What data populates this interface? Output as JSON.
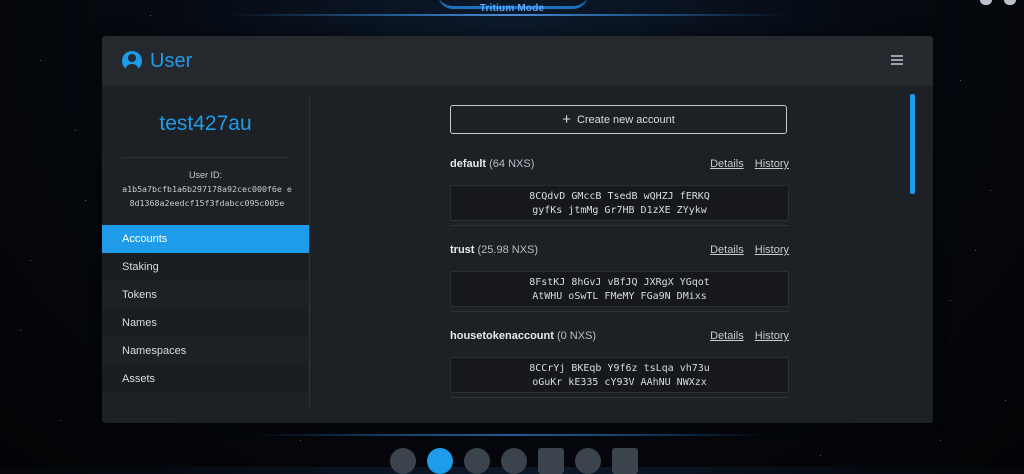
{
  "app": {
    "mode_label": "Tritium Mode"
  },
  "header": {
    "title": "User"
  },
  "sidebar": {
    "username": "test427au",
    "user_id_label": "User ID:",
    "user_id": "a1b5a7bcfb1a6b297178a92cec000f6e e8d1368a2eedcf15f3fdabcc095c005e",
    "items": [
      {
        "label": "Accounts",
        "active": true
      },
      {
        "label": "Staking",
        "active": false
      },
      {
        "label": "Tokens",
        "active": false
      },
      {
        "label": "Names",
        "active": false
      },
      {
        "label": "Namespaces",
        "active": false
      },
      {
        "label": "Assets",
        "active": false
      }
    ]
  },
  "main": {
    "create_label": "Create new account",
    "details_label": "Details",
    "history_label": "History",
    "accounts": [
      {
        "name": "default",
        "balance": "(64 NXS)",
        "address_line1": "8CQdvD GMccB TsedB wQHZJ fERKQ",
        "address_line2": "gyfKs jtmMg Gr7HB D1zXE ZYykw"
      },
      {
        "name": "trust",
        "balance": "(25.98 NXS)",
        "address_line1": "8FstKJ 8hGvJ vBfJQ JXRgX YGqot",
        "address_line2": "AtWHU oSwTL FMeMY FGa9N DMixs"
      },
      {
        "name": "housetokenaccount",
        "balance": "(0 NXS)",
        "address_line1": "8CCrYj BKEqb Y9f6z tsLqa vh73u",
        "address_line2": "oGuKr kE335 cY93V AAhNU NWXzx"
      }
    ]
  },
  "colors": {
    "accent": "#1e9be9",
    "panel": "#1d2024",
    "header": "#25292e"
  },
  "dock": {
    "icons": [
      "overview-icon",
      "user-icon",
      "send-icon",
      "transactions-icon",
      "address-book-icon",
      "settings-icon",
      "console-icon"
    ]
  }
}
